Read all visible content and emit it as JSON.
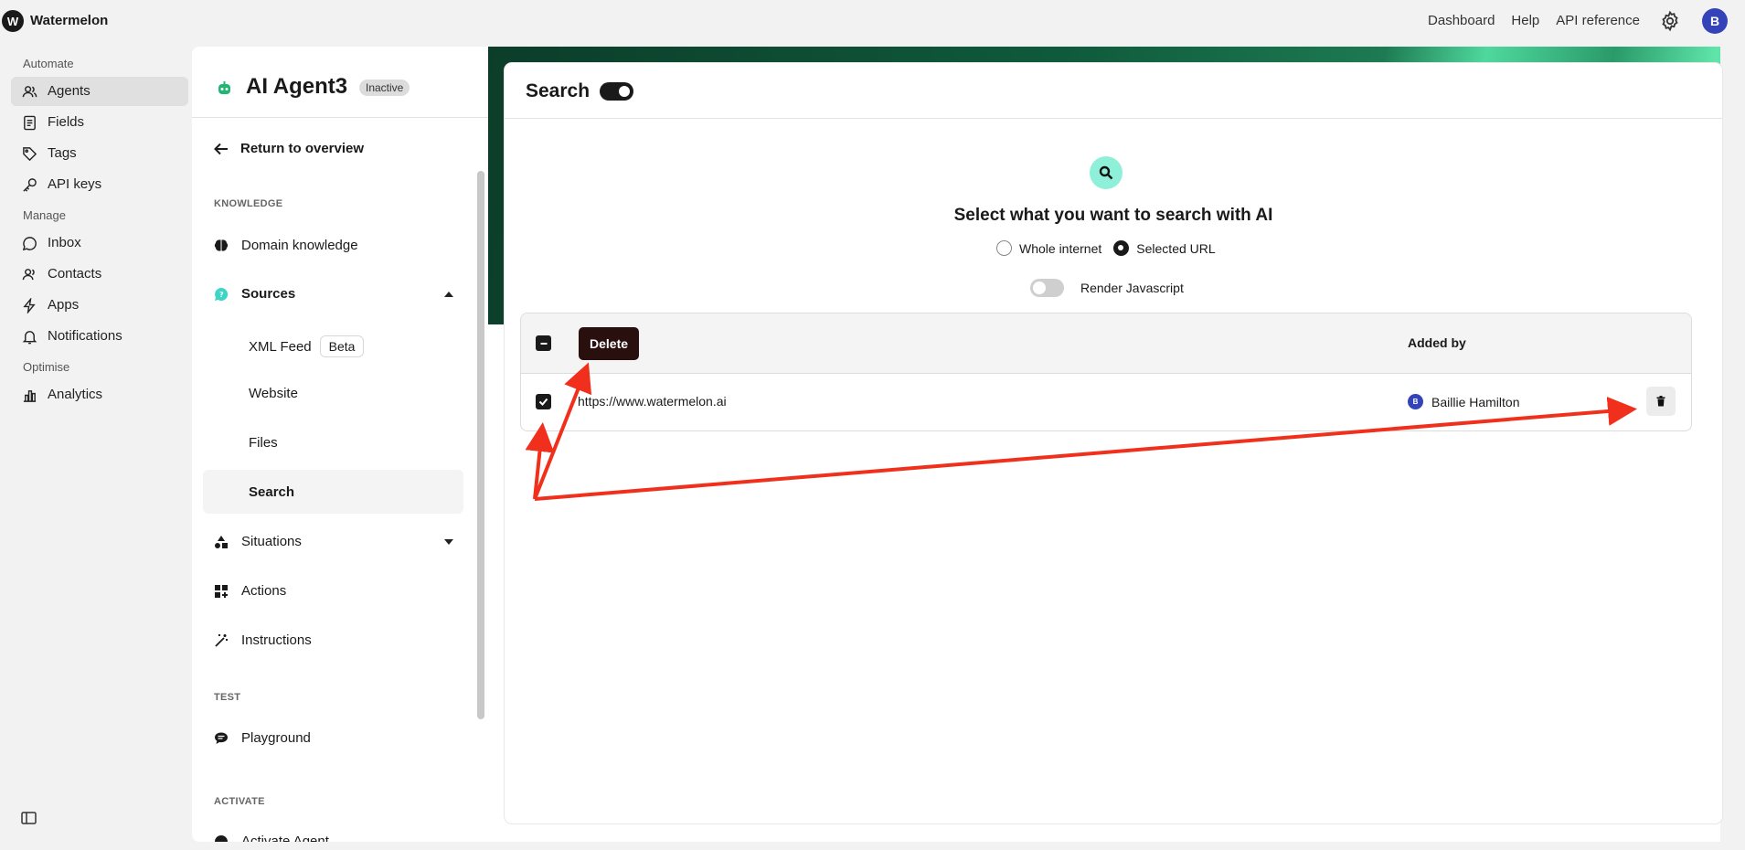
{
  "topbar": {
    "logo_letter": "W",
    "brand": "Watermelon",
    "links": [
      "Dashboard",
      "Help",
      "API reference"
    ],
    "avatar_letter": "B"
  },
  "leftnav": {
    "sections": [
      {
        "label": "Automate",
        "items": [
          {
            "label": "Agents",
            "icon": "agents-icon",
            "active": true
          },
          {
            "label": "Fields",
            "icon": "document-icon"
          },
          {
            "label": "Tags",
            "icon": "tag-icon"
          },
          {
            "label": "API keys",
            "icon": "key-icon"
          }
        ]
      },
      {
        "label": "Manage",
        "items": [
          {
            "label": "Inbox",
            "icon": "chat-bubble-icon"
          },
          {
            "label": "Contacts",
            "icon": "contacts-icon"
          },
          {
            "label": "Apps",
            "icon": "lightning-icon"
          },
          {
            "label": "Notifications",
            "icon": "bell-icon"
          }
        ]
      },
      {
        "label": "Optimise",
        "items": [
          {
            "label": "Analytics",
            "icon": "bar-chart-icon"
          }
        ]
      }
    ]
  },
  "agent": {
    "name": "AI Agent3",
    "status": "Inactive",
    "return_label": "Return to overview",
    "knowledge_label": "KNOWLEDGE",
    "domain_knowledge": "Domain knowledge",
    "sources": "Sources",
    "sub_items": {
      "xml_feed": "XML Feed",
      "beta": "Beta",
      "website": "Website",
      "files": "Files",
      "search": "Search"
    },
    "situations": "Situations",
    "actions": "Actions",
    "instructions": "Instructions",
    "test_label": "TEST",
    "playground": "Playground",
    "activate_label": "ACTIVATE",
    "activate_item": "Activate Agent"
  },
  "search_card": {
    "title": "Search",
    "enabled": true,
    "heading": "Select what you want to search with AI",
    "options": [
      "Whole internet",
      "Selected URL"
    ],
    "selected_option": "Selected URL",
    "render_js_label": "Render Javascript",
    "render_js_enabled": false,
    "table": {
      "delete_label": "Delete",
      "added_by_header": "Added by",
      "rows": [
        {
          "url": "https://www.watermelon.ai",
          "user_initial": "B",
          "user": "Baillie Hamilton",
          "checked": true
        }
      ]
    }
  },
  "colors": {
    "annotation_arrow": "#f0301c",
    "accent_green": "#4fd89e",
    "avatar_blue": "#3444b8"
  }
}
